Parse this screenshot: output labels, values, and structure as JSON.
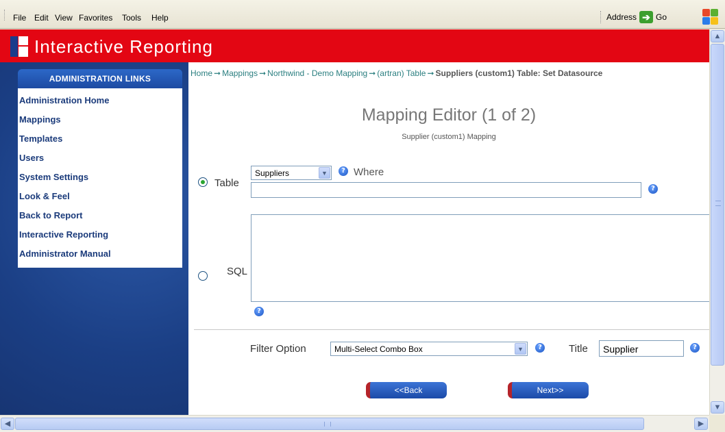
{
  "browser": {
    "menu": [
      "File",
      "Edit",
      "View",
      "Favorites",
      "Tools",
      "Help"
    ],
    "address_label": "Address",
    "go_label": "Go"
  },
  "app": {
    "title": "Interactive Reporting"
  },
  "sidebar": {
    "header": "ADMINISTRATION LINKS",
    "links": [
      "Administration Home",
      "Mappings",
      "Templates",
      "Users",
      "System Settings",
      "Look & Feel",
      "Back to Report",
      "Interactive Reporting",
      "Administrator Manual"
    ]
  },
  "breadcrumb": {
    "items": [
      "Home",
      "Mappings",
      "Northwind - Demo Mapping",
      "(artran) Table"
    ],
    "current": "Suppliers (custom1) Table: Set Datasource"
  },
  "editor": {
    "title": "Mapping Editor (1 of 2)",
    "subtitle": "Supplier (custom1) Mapping"
  },
  "form": {
    "table_label": "Table",
    "table_selected": "Suppliers",
    "where_label": "Where",
    "where_value": "",
    "sql_label": "SQL",
    "sql_value": "",
    "datasource_mode": "table",
    "filter_label": "Filter Option",
    "filter_selected": "Multi-Select Combo Box",
    "title_label": "Title",
    "title_value": "Supplier",
    "back_label": "<<Back",
    "next_label": "Next>>"
  }
}
